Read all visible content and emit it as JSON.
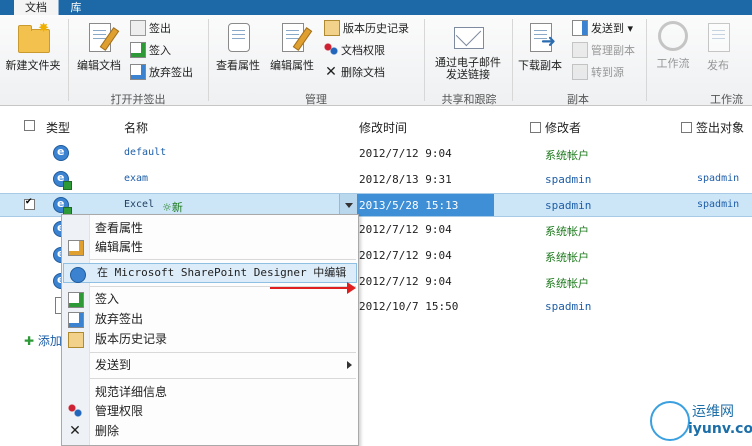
{
  "tabs": {
    "documents": "文档",
    "library": "库"
  },
  "ribbon": {
    "new_folder": "新建文件夹",
    "edit_document": "编辑文档",
    "check_out": "签出",
    "check_in": "签入",
    "discard_checkout": "放弃签出",
    "group_open_checkout": "打开并签出",
    "view_properties": "查看属性",
    "edit_properties": "编辑属性",
    "version_history": "版本历史记录",
    "document_permissions": "文档权限",
    "delete_document": "删除文档",
    "group_manage": "管理",
    "email_link_line1": "通过电子邮件",
    "email_link_line2": "发送链接",
    "group_share_track": "共享和跟踪",
    "download_copy": "下载副本",
    "send_to": "发送到",
    "manage_copies": "管理副本",
    "go_to_source": "转到源",
    "group_copies": "副本",
    "workflows": "工作流",
    "publish": "发布",
    "group_workflow": "工作流"
  },
  "list": {
    "headers": {
      "type": "类型",
      "name": "名称",
      "modified": "修改时间",
      "modified_by": "修改者",
      "checked_out_to": "签出对象"
    },
    "rows": [
      {
        "name": "default",
        "modified": "2012/7/12 9:04",
        "modified_by": "系统帐户",
        "checked_out_to": ""
      },
      {
        "name": "exam",
        "modified": "2012/8/13 9:31",
        "modified_by": "spadmin",
        "checked_out_to": "spadmin"
      },
      {
        "name": "Excel",
        "new_tag": "新",
        "modified": "2013/5/28 15:13",
        "modified_by": "spadmin",
        "checked_out_to": "spadmin"
      },
      {
        "name": "",
        "modified": "2012/7/12 9:04",
        "modified_by": "系统帐户",
        "checked_out_to": ""
      },
      {
        "name": "",
        "modified": "2012/7/12 9:04",
        "modified_by": "系统帐户",
        "checked_out_to": ""
      },
      {
        "name": "",
        "modified": "2012/7/12 9:04",
        "modified_by": "系统帐户",
        "checked_out_to": ""
      },
      {
        "name": "",
        "modified": "2012/10/7 15:50",
        "modified_by": "spadmin",
        "checked_out_to": ""
      }
    ],
    "add_new": "添加"
  },
  "menu": {
    "view_properties": "查看属性",
    "edit_properties": "编辑属性",
    "edit_in_spd": "在 Microsoft SharePoint Designer 中编辑",
    "check_in": "签入",
    "discard_checkout": "放弃签出",
    "version_history": "版本历史记录",
    "send_to": "发送到",
    "compliance_details": "规范详细信息",
    "manage_permissions": "管理权限",
    "delete": "删除"
  },
  "watermark": {
    "top": "运维网",
    "bottom": "iyunv.com"
  },
  "colors": {
    "tab_bar": "#1d69a8",
    "selected_row": "#cde6f7",
    "link": "#1e5ea8",
    "arrow": "#e02020"
  }
}
